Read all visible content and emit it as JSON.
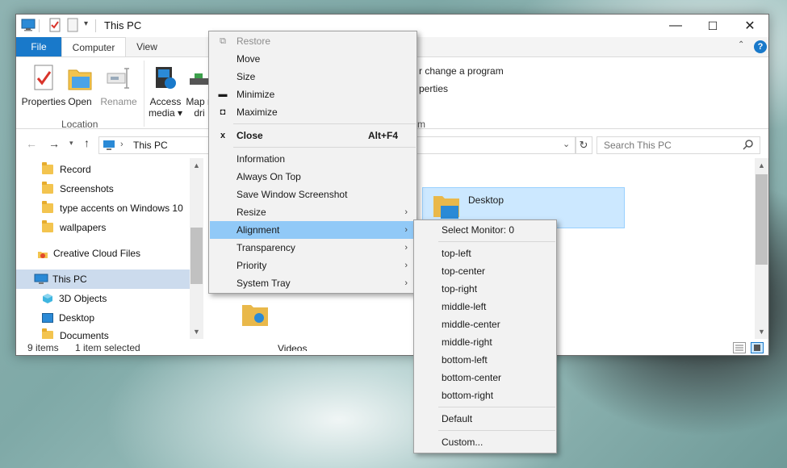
{
  "window": {
    "title": "This PC",
    "controls": {
      "minimize": "—",
      "maximize": "☐",
      "close": "✕"
    }
  },
  "ribbon": {
    "tabs": [
      "File",
      "Computer",
      "View"
    ],
    "buttons": [
      {
        "label": "Properties"
      },
      {
        "label": "Open"
      },
      {
        "label": "Rename"
      },
      {
        "label_line1": "Access",
        "label_line2": "media"
      },
      {
        "label_line1": "Map n",
        "label_line2": "dri"
      }
    ],
    "group_location": "Location",
    "group_right_partial": "m",
    "right_link1": "r change a program",
    "right_link2": "perties"
  },
  "address": {
    "path": "This PC",
    "search_placeholder": "Search This PC"
  },
  "nav": {
    "items": [
      {
        "label": "Record",
        "type": "folder"
      },
      {
        "label": "Screenshots",
        "type": "folder"
      },
      {
        "label": "type accents on Windows 10",
        "type": "folder"
      },
      {
        "label": "wallpapers",
        "type": "folder"
      },
      {
        "label": "Creative Cloud Files",
        "type": "cloud"
      },
      {
        "label": "This PC",
        "type": "pc",
        "selected": true
      },
      {
        "label": "3D Objects",
        "type": "3d"
      },
      {
        "label": "Desktop",
        "type": "desktop"
      },
      {
        "label": "Documents",
        "type": "folder"
      }
    ]
  },
  "content": {
    "selected_item": "Desktop",
    "partial_item": "Videos"
  },
  "status": {
    "count": "9 items",
    "selection": "1 item selected"
  },
  "system_menu": {
    "items": [
      {
        "label": "Restore",
        "disabled": true,
        "mark": "restore"
      },
      {
        "label": "Move"
      },
      {
        "label": "Size"
      },
      {
        "label": "Minimize",
        "mark": "minimize"
      },
      {
        "label": "Maximize",
        "mark": "maximize"
      },
      {
        "label": "Close",
        "accel": "Alt+F4",
        "mark": "x",
        "bold": true
      },
      {
        "label": "Information"
      },
      {
        "label": "Always On Top"
      },
      {
        "label": "Save Window Screenshot"
      },
      {
        "label": "Resize",
        "submenu": true
      },
      {
        "label": "Alignment",
        "submenu": true,
        "highlighted": true
      },
      {
        "label": "Transparency",
        "submenu": true
      },
      {
        "label": "Priority",
        "submenu": true
      },
      {
        "label": "System Tray",
        "submenu": true
      }
    ]
  },
  "alignment_menu": {
    "header": "Select Monitor: 0",
    "items": [
      "top-left",
      "top-center",
      "top-right",
      "middle-left",
      "middle-center",
      "middle-right",
      "bottom-left",
      "bottom-center",
      "bottom-right"
    ],
    "default": "Default",
    "custom": "Custom..."
  },
  "colors": {
    "accent": "#1979ca",
    "menu_highlight": "#91c9f7",
    "selection": "#cce8ff",
    "folder": "#f3c44f"
  }
}
